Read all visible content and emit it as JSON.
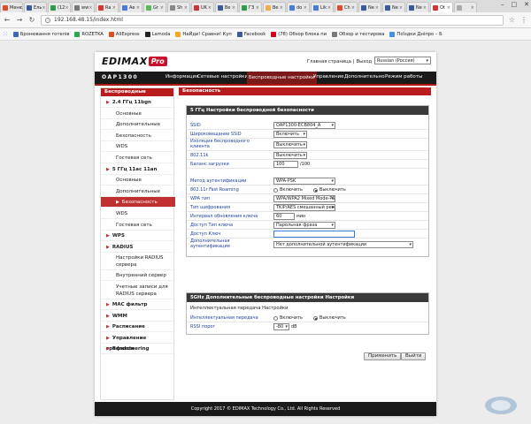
{
  "browser": {
    "tabs": [
      {
        "label": "Меню",
        "color": "#e04b2a"
      },
      {
        "label": "Ель",
        "color": "#3b5998"
      },
      {
        "label": "(12",
        "color": "#2b9d4a"
      },
      {
        "label": "ww",
        "color": "#777777"
      },
      {
        "label": "Ra",
        "color": "#d33"
      },
      {
        "label": "Ae",
        "color": "#4a7bd5"
      },
      {
        "label": "Gr",
        "color": "#5cb85c"
      },
      {
        "label": "Sh",
        "color": "#888"
      },
      {
        "label": "UK",
        "color": "#c33"
      },
      {
        "label": "Be",
        "color": "#3b5998"
      },
      {
        "label": "ГЗ",
        "color": "#2b9d4a"
      },
      {
        "label": "Be",
        "color": "#f0ad4e"
      },
      {
        "label": "do",
        "color": "#4a7bd5"
      },
      {
        "label": "Lik",
        "color": "#4a7bd5"
      },
      {
        "label": "Ch",
        "color": "#e04b2a"
      },
      {
        "label": "Ne",
        "color": "#3b5998"
      },
      {
        "label": "Ne",
        "color": "#3b5998"
      },
      {
        "label": "Ne",
        "color": "#3b5998"
      },
      {
        "label": "Ot",
        "color": "#d33"
      },
      {
        "label": "",
        "color": "#aaa"
      }
    ],
    "url": "192.168.48.15/index.html",
    "bookmarks": [
      {
        "label": "Бронювання готелів",
        "color": "#3b6ab8"
      },
      {
        "label": "ROZETKA",
        "color": "#2ea44f"
      },
      {
        "label": "AliExpress",
        "color": "#e8491d"
      },
      {
        "label": "Lamoda",
        "color": "#222222"
      },
      {
        "label": "НаЙди! Сравни! Куп",
        "color": "#f5a623"
      },
      {
        "label": "Facebook",
        "color": "#3b5998"
      },
      {
        "label": "(78) Обзор блока пи",
        "color": "#d0021b"
      },
      {
        "label": "Обзор и тестирова",
        "color": "#7a7a7a"
      },
      {
        "label": "Поїздки Дніпро – Б",
        "color": "#4a90e2"
      }
    ]
  },
  "header": {
    "logo": "EDIMAX",
    "logo_badge": "Pro",
    "link_home": "Главная страница",
    "separator": "|",
    "link_logout": "Выход",
    "language": "Russian (Россия)",
    "model": "OAP1300"
  },
  "nav": [
    "Информация",
    "Сетевые настройки",
    "Беспроводные настройки",
    "Управление",
    "Дополнительно",
    "Режим работы"
  ],
  "sidebar": {
    "title": "Беспроводные",
    "items": [
      {
        "label": "2.4 ГГц 11bgn",
        "type": "group"
      },
      {
        "label": "Основные",
        "type": "sub"
      },
      {
        "label": "Дополнительные",
        "type": "sub"
      },
      {
        "label": "Безопасность",
        "type": "sub"
      },
      {
        "label": "WDS",
        "type": "sub"
      },
      {
        "label": "Гостевая сеть",
        "type": "sub"
      },
      {
        "label": "5 ГГц 11ac 11an",
        "type": "group"
      },
      {
        "label": "Основные",
        "type": "sub"
      },
      {
        "label": "Дополнительные",
        "type": "sub"
      },
      {
        "label": "Безопасность",
        "type": "sub",
        "active": true
      },
      {
        "label": "WDS",
        "type": "sub"
      },
      {
        "label": "Гостевая сеть",
        "type": "sub"
      },
      {
        "label": "WPS",
        "type": "group"
      },
      {
        "label": "RADIUS",
        "type": "group"
      },
      {
        "label": "Настройки RADIUS сервера",
        "type": "sub2"
      },
      {
        "label": "Внутренний сервер",
        "type": "sub"
      },
      {
        "label": "Учетные записи для RADIUS сервера",
        "type": "sub2"
      },
      {
        "label": "MAC фильтр",
        "type": "group"
      },
      {
        "label": "WMM",
        "type": "group"
      },
      {
        "label": "Расписание",
        "type": "group"
      },
      {
        "label": "Управление трафиком",
        "type": "group"
      },
      {
        "label": "Bandsteering",
        "type": "group"
      }
    ]
  },
  "content": {
    "title": "Безопасность",
    "panel1": {
      "title": "5 ГГц Настройки беспроводной безопасности",
      "ssid_label": "SSID",
      "ssid_value": "OAP1300-ECB804_A",
      "broadcast_label": "Широковещание SSID",
      "broadcast_value": "Включить",
      "isolation_label": "Изоляция беспроводного клиента",
      "isolation_value": "Выключить",
      "k_label": "802.11k",
      "k_value": "Выключить",
      "lb_label": "Баланс загрузки",
      "lb_value": "100",
      "lb_unit": "/100",
      "auth_label": "Метод аутентификации",
      "auth_value": "WPA-PSK",
      "r_label": "802.11r Fast Roaming",
      "r_on": "Включить",
      "r_off": "Выключить",
      "wpa_label": "WPA тип",
      "wpa_value": "WPA/WPA2 Mixed Mode-PSK",
      "enc_label": "Тип шифрования",
      "enc_value": "TKIP/AES смешанный режим",
      "interval_label": "Интервал обновления ключа",
      "interval_value": "60",
      "interval_unit": "мин",
      "keytype_label": "Доступ Тип ключа",
      "keytype_value": "Парольная фраза",
      "key_label": "Доступ Ключ",
      "key_value": "",
      "extra_label": "Дополнительная аутентификация",
      "extra_value": "Нет дополнительной аутентификации"
    },
    "panel2": {
      "title": "5GHz Дополнительные беспроводные настройки Настройки",
      "sub_title": "Интеллектуальная передача Настройки",
      "smart_label": "Интеллектуальная передача",
      "smart_on": "Включить",
      "smart_off": "Выключить",
      "rssi_label": "RSSI порог",
      "rssi_value": "-80",
      "rssi_unit": "dB"
    },
    "apply": "Применить",
    "cancel": "Выйти"
  },
  "footer": "Copyright 2017 © EDIMAX Technology Co., Ltd. All Rights Reserved"
}
